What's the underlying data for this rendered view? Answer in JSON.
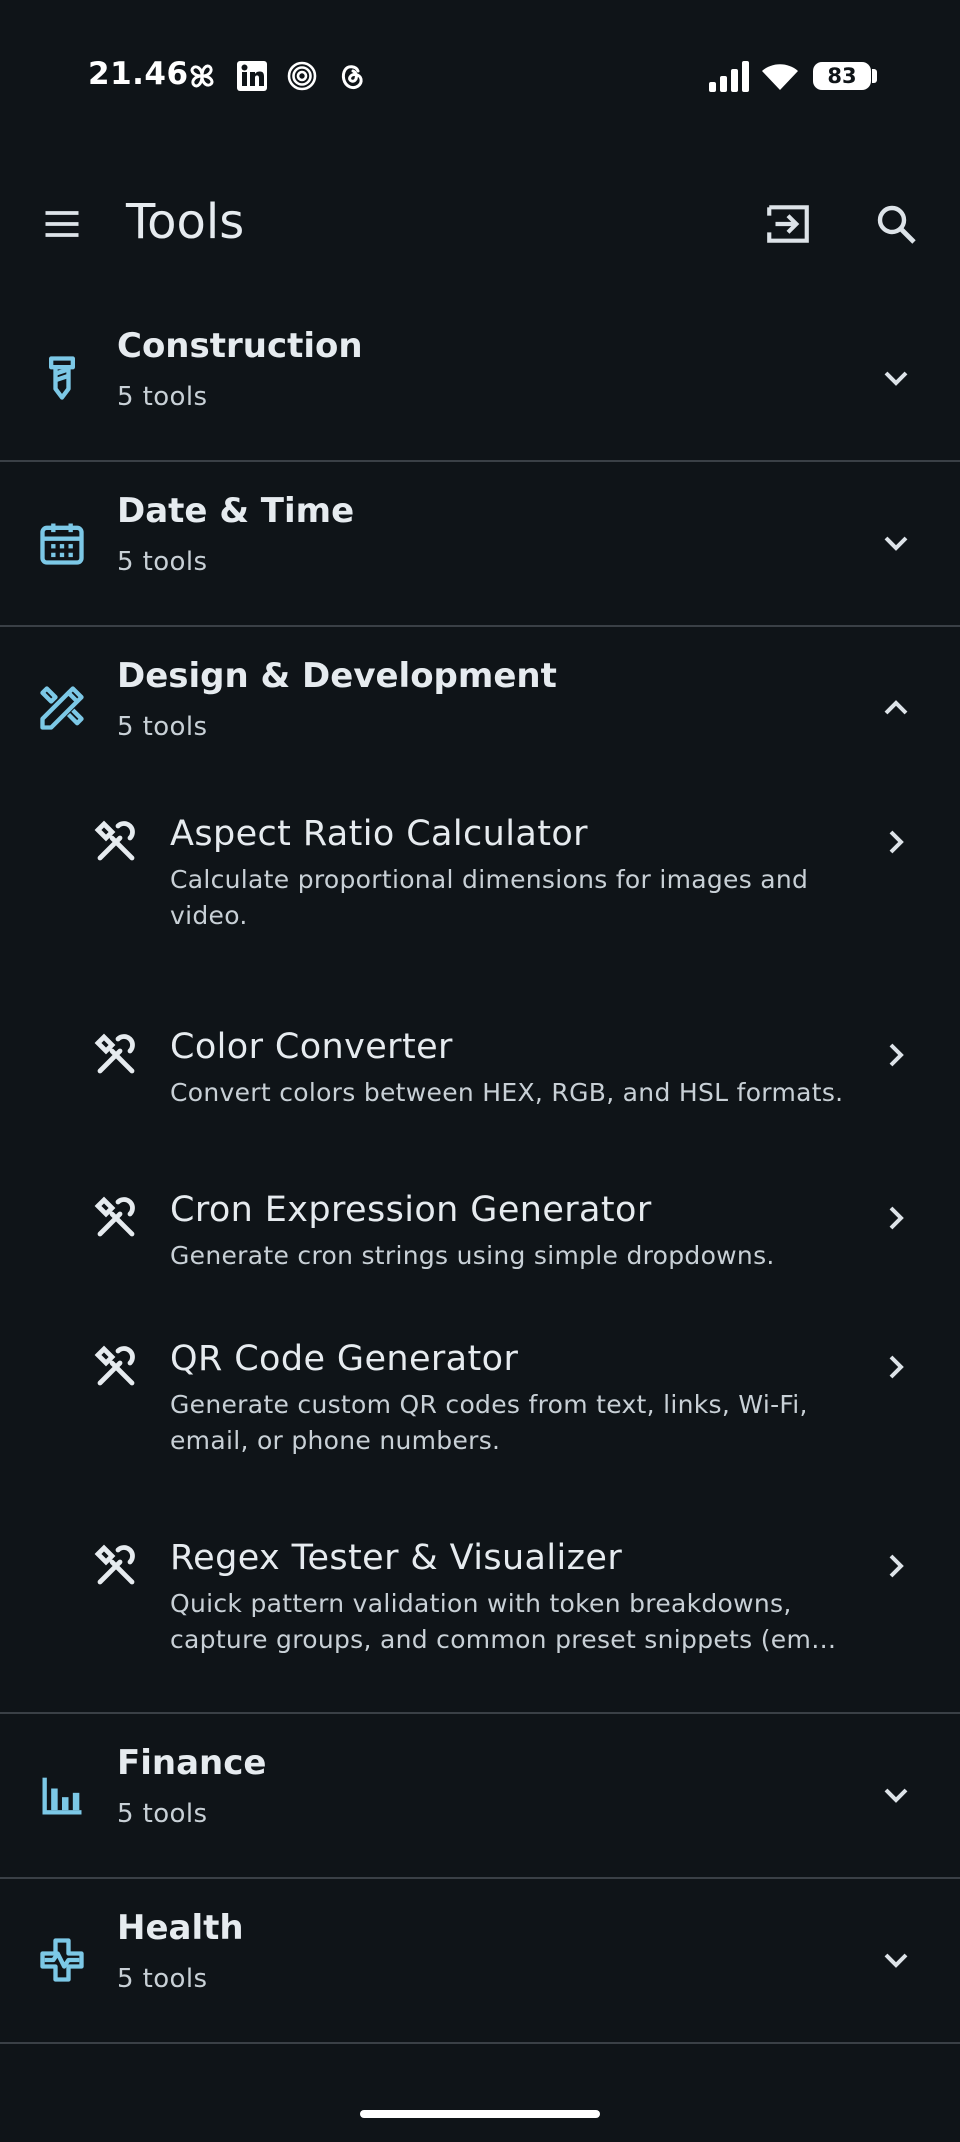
{
  "status_bar": {
    "time": "21.46",
    "battery": "83",
    "app_icons": [
      "pinwheel-icon",
      "linkedin-icon",
      "target-icon",
      "threads-icon"
    ]
  },
  "app_bar": {
    "title": "Tools",
    "actions": [
      "menu-icon",
      "login-icon",
      "search-icon"
    ]
  },
  "colors": {
    "background": "#0f1418",
    "accent_icon": "#7cc8e6",
    "divider": "#3a4046",
    "primary_text": "#e6ebef",
    "secondary_text": "#c8d0d6"
  },
  "categories": [
    {
      "title": "Construction",
      "count": "5 tools",
      "icon": "screw-icon",
      "expanded": false
    },
    {
      "title": "Date & Time",
      "count": "5 tools",
      "icon": "calendar-icon",
      "expanded": false
    },
    {
      "title": "Design & Development",
      "count": "5 tools",
      "icon": "design-tools-icon",
      "expanded": true,
      "tools": [
        {
          "title": "Aspect Ratio Calculator",
          "description": "Calculate proportional dimensions for images and video."
        },
        {
          "title": "Color Converter",
          "description": "Convert colors between HEX, RGB, and HSL formats."
        },
        {
          "title": "Cron Expression Generator",
          "description": "Generate cron strings using simple dropdowns."
        },
        {
          "title": "QR Code Generator",
          "description": "Generate custom QR codes from text, links, Wi-Fi, email, or phone numbers."
        },
        {
          "title": "Regex Tester & Visualizer",
          "description": "Quick pattern validation with token breakdowns, capture groups, and common preset snippets (em…"
        }
      ]
    },
    {
      "title": "Finance",
      "count": "5 tools",
      "icon": "bar-chart-icon",
      "expanded": false
    },
    {
      "title": "Health",
      "count": "5 tools",
      "icon": "health-icon",
      "expanded": false
    }
  ]
}
